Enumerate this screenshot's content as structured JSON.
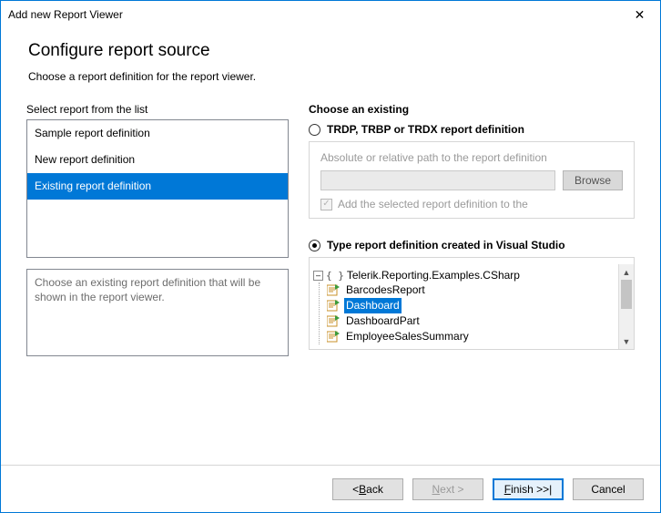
{
  "window": {
    "title": "Add new Report Viewer",
    "close_glyph": "✕"
  },
  "heading": "Configure report source",
  "subheading": "Choose a report definition for the report viewer.",
  "left": {
    "label": "Select report from the list",
    "items": [
      {
        "label": "Sample report definition"
      },
      {
        "label": "New report definition"
      },
      {
        "label": "Existing report definition"
      }
    ],
    "selected_index": 2,
    "helptext": "Choose an existing report definition that will be shown in the report viewer."
  },
  "right": {
    "heading": "Choose an existing",
    "option_file": {
      "label": "TRDP, TRBP or TRDX report definition",
      "selected": false,
      "path_desc": "Absolute or relative path to the report definition",
      "path_value": "",
      "browse_label": "Browse",
      "add_checkbox_label": "Add the selected report definition to the",
      "add_checkbox_checked": true
    },
    "option_type": {
      "label": "Type report definition created in Visual Studio",
      "selected": true,
      "tree": {
        "namespace": "Telerik.Reporting.Examples.CSharp",
        "items": [
          "BarcodesReport",
          "Dashboard",
          "DashboardPart",
          "EmployeeSalesSummary"
        ],
        "selected_item": "Dashboard",
        "expander_glyph": "–",
        "scroll": {
          "up_glyph": "▲",
          "down_glyph": "▼"
        }
      }
    }
  },
  "footer": {
    "back_prefix": "< ",
    "back_u": "B",
    "back_rest": "ack",
    "next_u": "N",
    "next_rest": "ext >",
    "finish_u": "F",
    "finish_rest": "inish >>|",
    "cancel": "Cancel"
  }
}
